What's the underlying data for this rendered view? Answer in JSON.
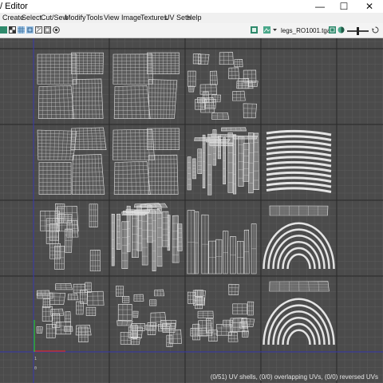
{
  "window": {
    "title": "/ Editor",
    "minimize_glyph": "—",
    "maximize_glyph": "☐",
    "close_glyph": "✕"
  },
  "menu": [
    "Create",
    "Select",
    "Cut/Sew",
    "Modify",
    "Tools",
    "View",
    "Image",
    "Textures",
    "UV Sets",
    "Help"
  ],
  "toolbar": {
    "texture_name": "legs_RO1001.tga",
    "left_icons": [
      "image-toggle-icon",
      "checker-icon",
      "grid-display-icon",
      "uv-tile-icon",
      "isolate-icon",
      "snap-icon",
      "dot-icon"
    ],
    "right_icons": [
      "texture-display-icon",
      "exposure-icon",
      "gamma-icon"
    ],
    "accent_color": "#4aa88a"
  },
  "viewport": {
    "status": "(0/51) UV shells, (0/0) overlapping UVs, (0/0) reversed UVs",
    "axis_labels": [
      "0",
      "1"
    ]
  }
}
